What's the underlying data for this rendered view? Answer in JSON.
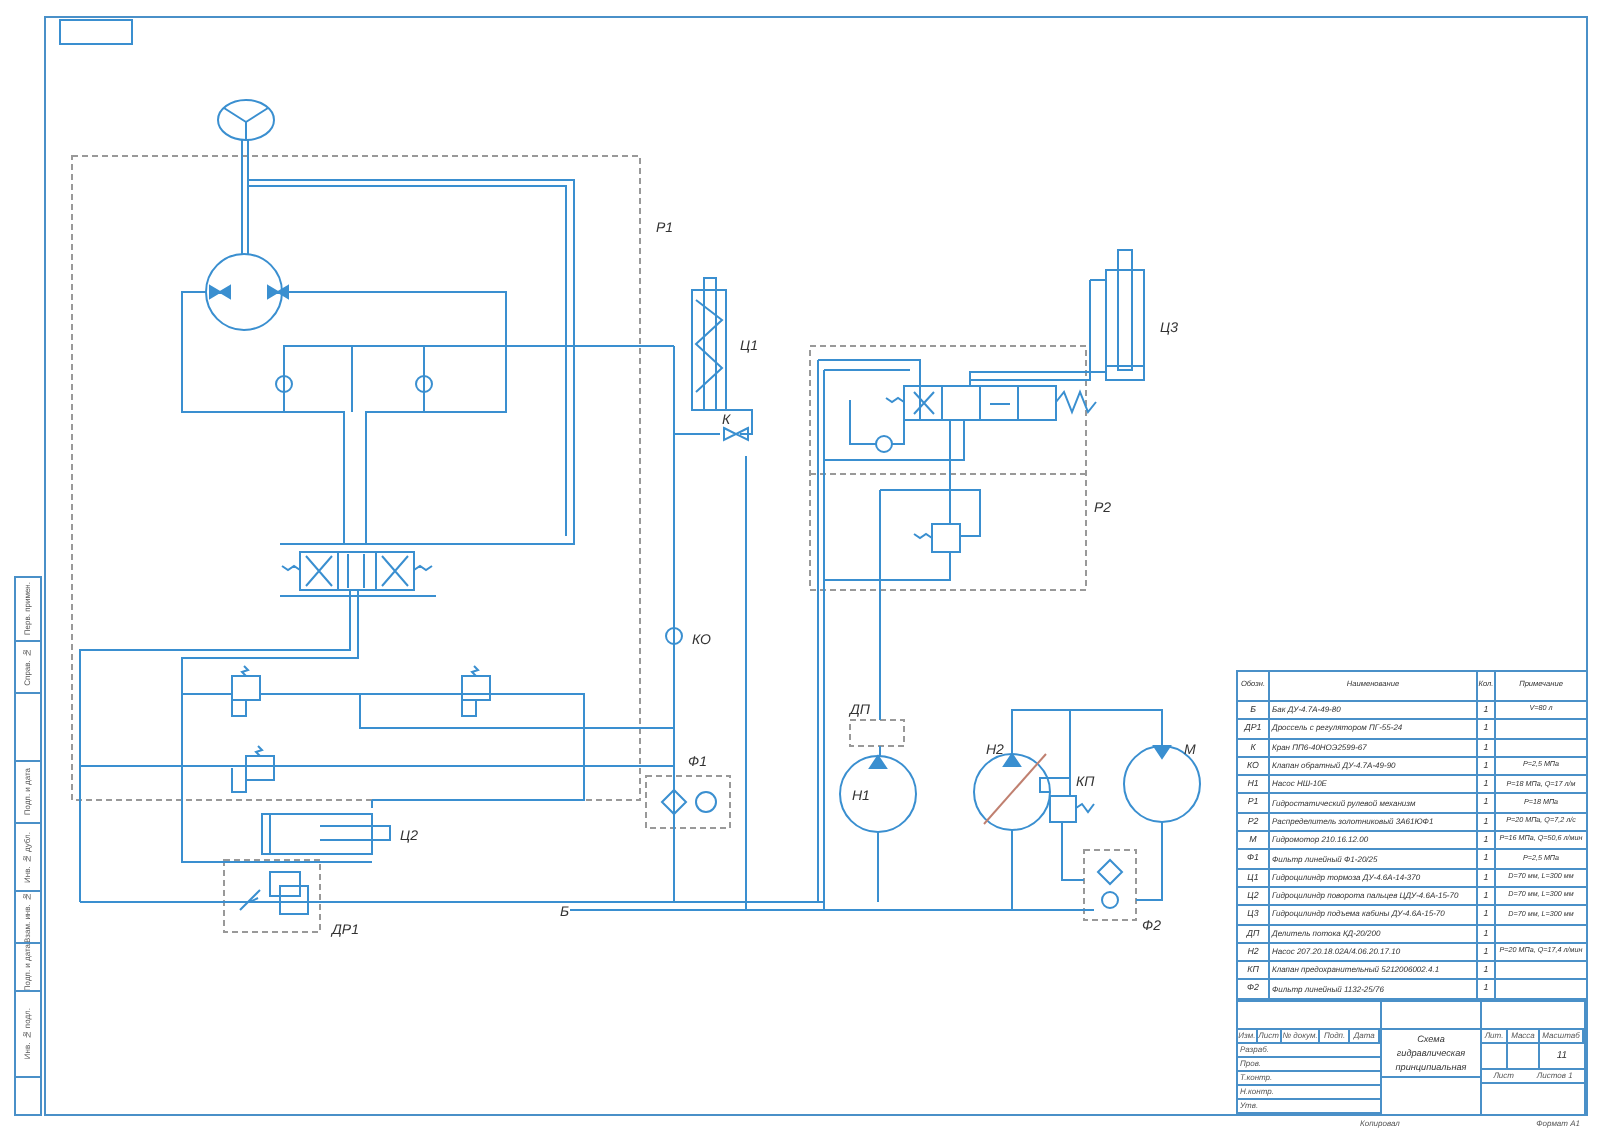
{
  "schematic": {
    "labels": [
      "Р1",
      "Ц1",
      "К",
      "КО",
      "Ф1",
      "Ц2",
      "ДР1",
      "Б",
      "Р2",
      "Ц3",
      "ДП",
      "Н1",
      "Н2",
      "КП",
      "М",
      "Ф2"
    ]
  },
  "parts_table": {
    "columns": [
      "Обозн.",
      "Наименование",
      "Кол.",
      "Примечание"
    ],
    "rows": [
      {
        "designation": "Б",
        "name": "Бак ДУ-4.7А-49-80",
        "quantity": "1",
        "note": "V=80 л"
      },
      {
        "designation": "ДР1",
        "name": "Дроссель с регулятором ПГ-55-24",
        "quantity": "1",
        "note": ""
      },
      {
        "designation": "К",
        "name": "Кран ПП6-40НОЭ2599-67",
        "quantity": "1",
        "note": ""
      },
      {
        "designation": "КО",
        "name": "Клапан обратный ДУ-4.7А-49-90",
        "quantity": "1",
        "note": "P=2,5 МПа"
      },
      {
        "designation": "Н1",
        "name": "Насос НШ-10Е",
        "quantity": "1",
        "note": "P=18 МПа, Q=17 л/м"
      },
      {
        "designation": "Р1",
        "name": "Гидростатический рулевой механизм",
        "quantity": "1",
        "note": "P=18 МПа"
      },
      {
        "designation": "Р2",
        "name": "Распределитель золотниковый 3А61ЮФ1",
        "quantity": "1",
        "note": "P=20 МПа, Q=7,2 л/с"
      },
      {
        "designation": "М",
        "name": "Гидромотор 210.16.12.00",
        "quantity": "1",
        "note": "P=16 МПа, Q=50,6 л/мин"
      },
      {
        "designation": "Ф1",
        "name": "Фильтр линейный Ф1-20/25",
        "quantity": "1",
        "note": "P=2,5 МПа"
      },
      {
        "designation": "Ц1",
        "name": "Гидроцилиндр тормоза ДУ-4.6А-14-370",
        "quantity": "1",
        "note": "D=70 мм, L=300 мм"
      },
      {
        "designation": "Ц2",
        "name": "Гидроцилиндр поворота пальцев ЦДУ-4.6А-15-70",
        "quantity": "1",
        "note": "D=70 мм, L=300 мм"
      },
      {
        "designation": "Ц3",
        "name": "Гидроцилиндр подъема кабины ДУ-4.6А-15-70",
        "quantity": "1",
        "note": "D=70 мм, L=300 мм"
      },
      {
        "designation": "ДП",
        "name": "Делитель потока КД-20/200",
        "quantity": "1",
        "note": ""
      },
      {
        "designation": "Н2",
        "name": "Насос 207.20.18.02А/4.06.20.17.10",
        "quantity": "1",
        "note": "P=20 МПа, Q=17,4 л/мин"
      },
      {
        "designation": "КП",
        "name": "Клапан предохранительный 5212006002.4.1",
        "quantity": "1",
        "note": ""
      },
      {
        "designation": "Ф2",
        "name": "Фильтр линейный 1132-25/76",
        "quantity": "1",
        "note": ""
      }
    ]
  },
  "title_block": {
    "change_headers": [
      "Изм.",
      "Лист",
      "№ докум.",
      "Подп.",
      "Дата"
    ],
    "roles": [
      "Разраб.",
      "Пров.",
      "Т.контр.",
      "Н.контр.",
      "Утв."
    ],
    "title": "Схема гидравлическая принципиальная",
    "letter_header": "Лит.",
    "mass_header": "Масса",
    "scale_header": "Масштаб",
    "scale": "11",
    "sheet": "Лист",
    "sheets": "Листов 1"
  },
  "side_stamp": {
    "fields": [
      "Перв. примен.",
      "Справ. №",
      "Подп. и дата",
      "Инв. № дубл.",
      "Взам. инв. №",
      "Подп. и дата",
      "Инв. № подл."
    ]
  },
  "footer": {
    "copied": "Копировал",
    "format": "Формат А1"
  }
}
